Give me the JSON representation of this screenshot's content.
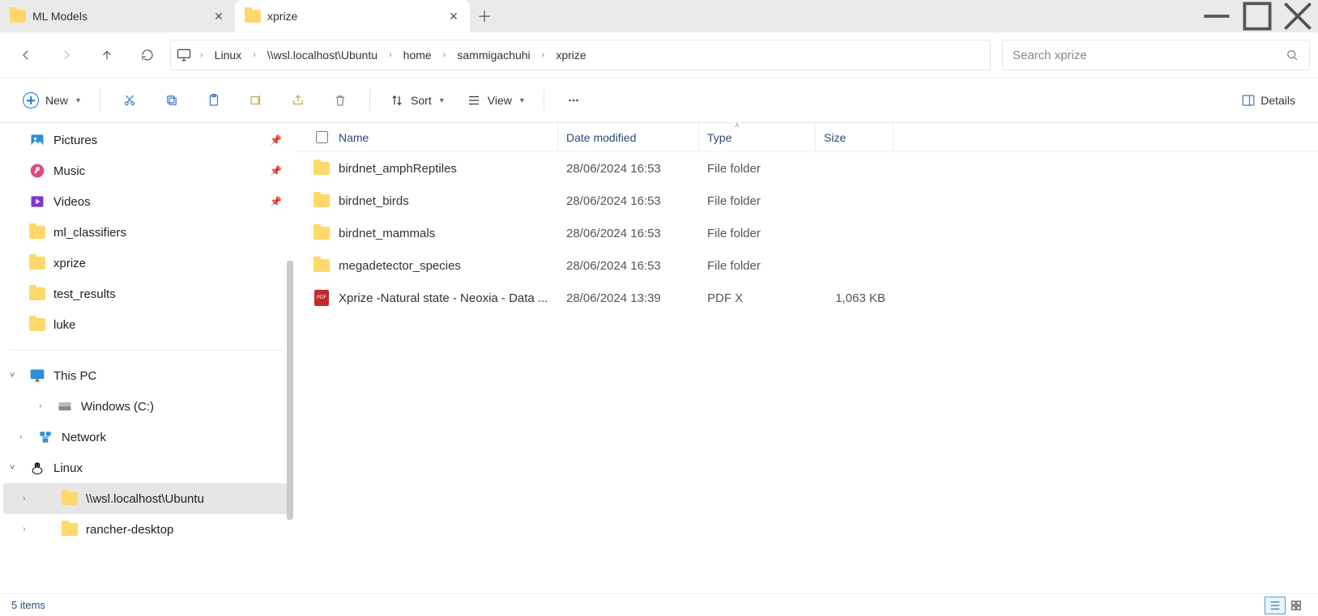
{
  "tabs": [
    {
      "title": "ML Models",
      "active": false
    },
    {
      "title": "xprize",
      "active": true
    }
  ],
  "breadcrumbs": [
    "Linux",
    "\\\\wsl.localhost\\Ubuntu",
    "home",
    "sammigachuhi",
    "xprize"
  ],
  "search": {
    "placeholder": "Search xprize"
  },
  "toolbar": {
    "new": "New",
    "sort": "Sort",
    "view": "View",
    "details": "Details"
  },
  "columns": {
    "name": "Name",
    "date": "Date modified",
    "type": "Type",
    "size": "Size"
  },
  "sidebar": {
    "quick": [
      {
        "label": "Pictures",
        "icon": "pictures",
        "pinned": true
      },
      {
        "label": "Music",
        "icon": "music",
        "pinned": true
      },
      {
        "label": "Videos",
        "icon": "videos",
        "pinned": true
      },
      {
        "label": "ml_classifiers",
        "icon": "folder"
      },
      {
        "label": "xprize",
        "icon": "folder"
      },
      {
        "label": "test_results",
        "icon": "folder"
      },
      {
        "label": "luke",
        "icon": "folder"
      }
    ],
    "thispc_label": "This PC",
    "thispc": [
      {
        "label": "Windows (C:)",
        "icon": "drive"
      }
    ],
    "network_label": "Network",
    "linux_label": "Linux",
    "linux": [
      {
        "label": "\\\\wsl.localhost\\Ubuntu",
        "selected": true
      },
      {
        "label": "rancher-desktop"
      }
    ]
  },
  "files": [
    {
      "name": "birdnet_amphReptiles",
      "date": "28/06/2024 16:53",
      "type": "File folder",
      "size": "",
      "icon": "folder"
    },
    {
      "name": "birdnet_birds",
      "date": "28/06/2024 16:53",
      "type": "File folder",
      "size": "",
      "icon": "folder"
    },
    {
      "name": "birdnet_mammals",
      "date": "28/06/2024 16:53",
      "type": "File folder",
      "size": "",
      "icon": "folder"
    },
    {
      "name": "megadetector_species",
      "date": "28/06/2024 16:53",
      "type": "File folder",
      "size": "",
      "icon": "folder"
    },
    {
      "name": "Xprize -Natural state - Neoxia - Data ...",
      "date": "28/06/2024 13:39",
      "type": "PDF X",
      "size": "1,063 KB",
      "icon": "pdf"
    }
  ],
  "status": {
    "text": "5 items"
  }
}
